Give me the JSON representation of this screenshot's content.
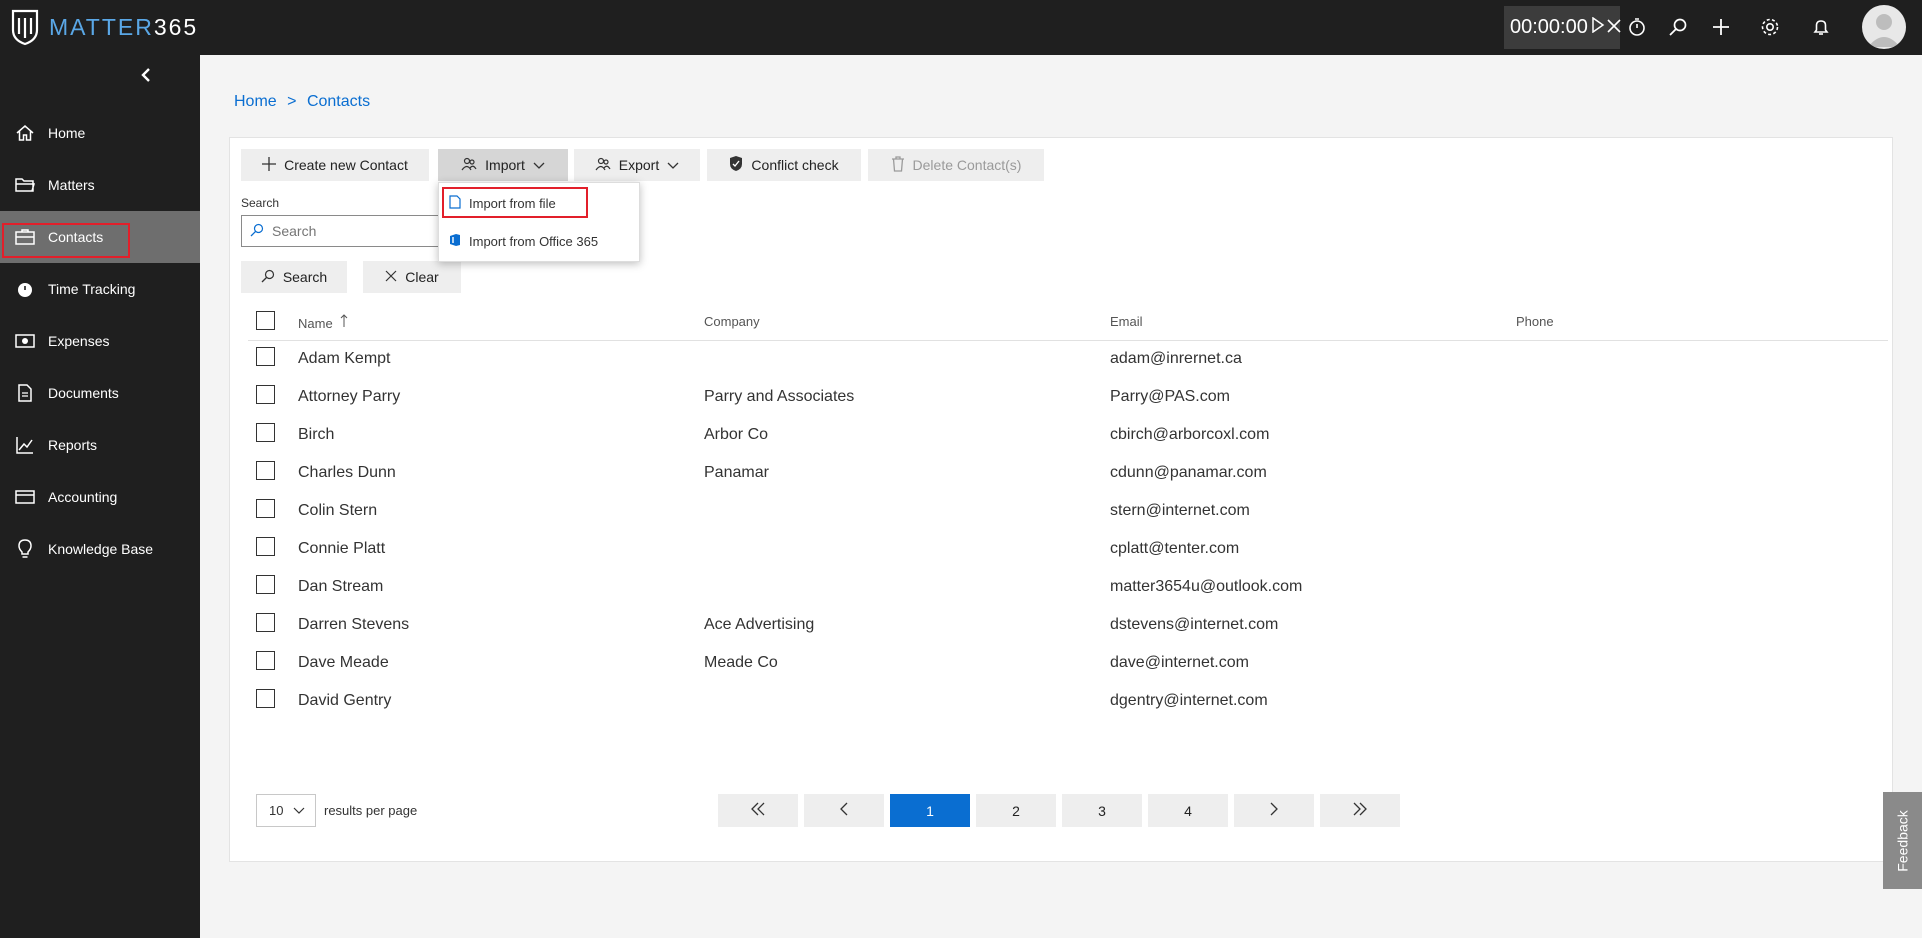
{
  "app": {
    "name_prefix": "MATTER",
    "name_suffix": "365",
    "timer": "00:00:00"
  },
  "sidebar": {
    "items": [
      {
        "label": "Home",
        "icon": "home-icon"
      },
      {
        "label": "Matters",
        "icon": "folder-icon"
      },
      {
        "label": "Contacts",
        "icon": "contacts-icon",
        "active": true
      },
      {
        "label": "Time Tracking",
        "icon": "stopwatch-icon"
      },
      {
        "label": "Expenses",
        "icon": "money-icon"
      },
      {
        "label": "Documents",
        "icon": "documents-icon"
      },
      {
        "label": "Reports",
        "icon": "chart-icon"
      },
      {
        "label": "Accounting",
        "icon": "wallet-icon"
      },
      {
        "label": "Knowledge Base",
        "icon": "lightbulb-icon"
      }
    ]
  },
  "breadcrumb": {
    "home": "Home",
    "sep": ">",
    "current": "Contacts"
  },
  "toolbar": {
    "create": "Create new Contact",
    "import": "Import",
    "export": "Export",
    "conflict": "Conflict check",
    "delete": "Delete Contact(s)"
  },
  "import_menu": {
    "from_file": "Import from file",
    "from_office": "Import from Office 365"
  },
  "search": {
    "label": "Search",
    "placeholder": "Search",
    "search_button": "Search",
    "clear_button": "Clear"
  },
  "table": {
    "columns": [
      "Name",
      "Company",
      "Email",
      "Phone"
    ],
    "rows": [
      {
        "name": "Adam Kempt",
        "company": "",
        "email": "adam@inrernet.ca",
        "phone": ""
      },
      {
        "name": "Attorney Parry",
        "company": "Parry and Associates",
        "email": "Parry@PAS.com",
        "phone": ""
      },
      {
        "name": "Birch",
        "company": "Arbor Co",
        "email": "cbirch@arborcoxl.com",
        "phone": ""
      },
      {
        "name": "Charles Dunn",
        "company": "Panamar",
        "email": "cdunn@panamar.com",
        "phone": ""
      },
      {
        "name": "Colin Stern",
        "company": "",
        "email": "stern@internet.com",
        "phone": ""
      },
      {
        "name": "Connie Platt",
        "company": "",
        "email": "cplatt@tenter.com",
        "phone": ""
      },
      {
        "name": "Dan Stream",
        "company": "",
        "email": "matter3654u@outlook.com",
        "phone": ""
      },
      {
        "name": "Darren Stevens",
        "company": "Ace Advertising",
        "email": "dstevens@internet.com",
        "phone": ""
      },
      {
        "name": "Dave Meade",
        "company": "Meade Co",
        "email": "dave@internet.com",
        "phone": ""
      },
      {
        "name": "David Gentry",
        "company": "",
        "email": "dgentry@internet.com",
        "phone": ""
      }
    ]
  },
  "pagination": {
    "per_page": "10",
    "per_page_label": "results per page",
    "first": "«",
    "prev": "‹",
    "pages": [
      "1",
      "2",
      "3",
      "4"
    ],
    "current": "1",
    "next": "›",
    "last": "»"
  },
  "feedback": "Feedback",
  "colors": {
    "accent": "#0a6ed1",
    "highlight": "#e21f2a",
    "topbar": "#1f1f1f"
  }
}
